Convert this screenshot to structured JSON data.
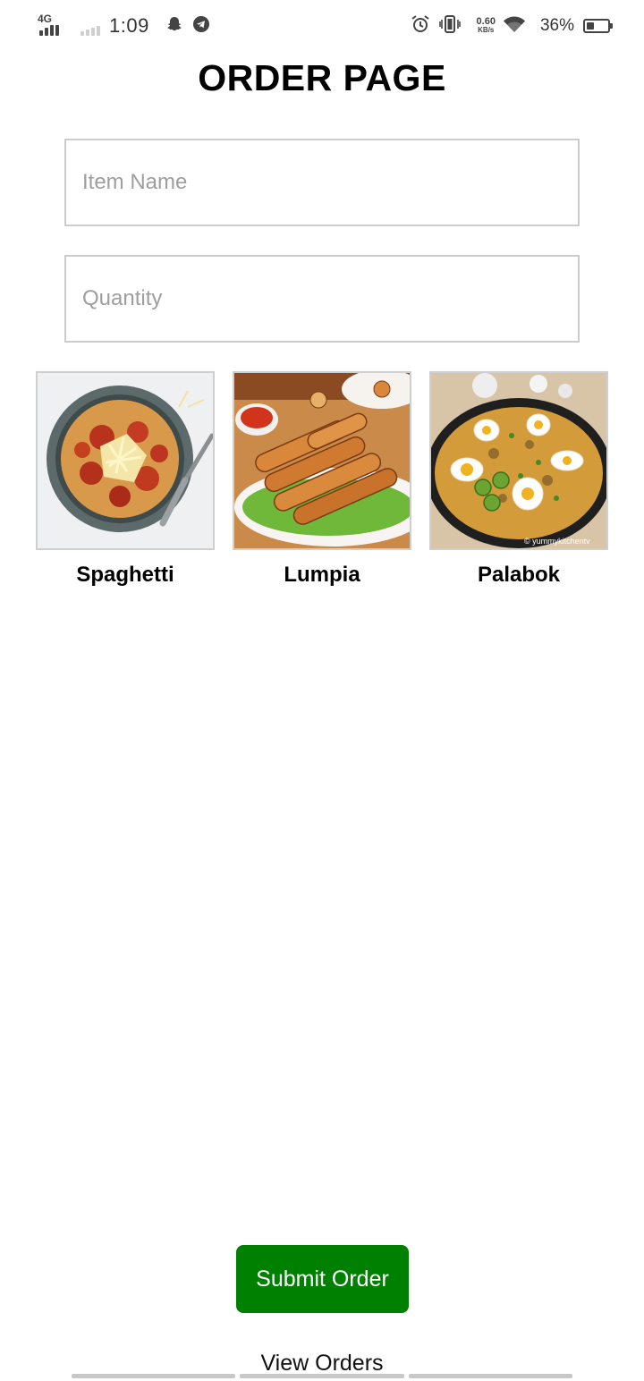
{
  "status_bar": {
    "network_label": "4G",
    "time": "1:09",
    "speed_value": "0.60",
    "speed_unit": "KB/s",
    "battery_percent_text": "36%",
    "battery_level": 0.36,
    "icons": [
      "signal-icon",
      "signal-weak-icon",
      "snapchat-icon",
      "telegram-icon",
      "alarm-icon",
      "vibrate-icon",
      "wifi-icon",
      "battery-icon"
    ]
  },
  "page": {
    "title": "ORDER PAGE"
  },
  "form": {
    "item_name": {
      "value": "",
      "placeholder": "Item Name"
    },
    "quantity": {
      "value": "",
      "placeholder": "Quantity"
    }
  },
  "menu": {
    "items": [
      {
        "name": "Spaghetti",
        "image": "spaghetti-image"
      },
      {
        "name": "Lumpia",
        "image": "lumpia-image"
      },
      {
        "name": "Palabok",
        "image": "palabok-image",
        "watermark": "© yummykitchentv"
      }
    ]
  },
  "actions": {
    "submit_label": "Submit Order",
    "view_orders_label": "View Orders"
  },
  "colors": {
    "submit_bg": "#008000",
    "input_border": "#cccccc",
    "placeholder": "#9e9e9e"
  }
}
